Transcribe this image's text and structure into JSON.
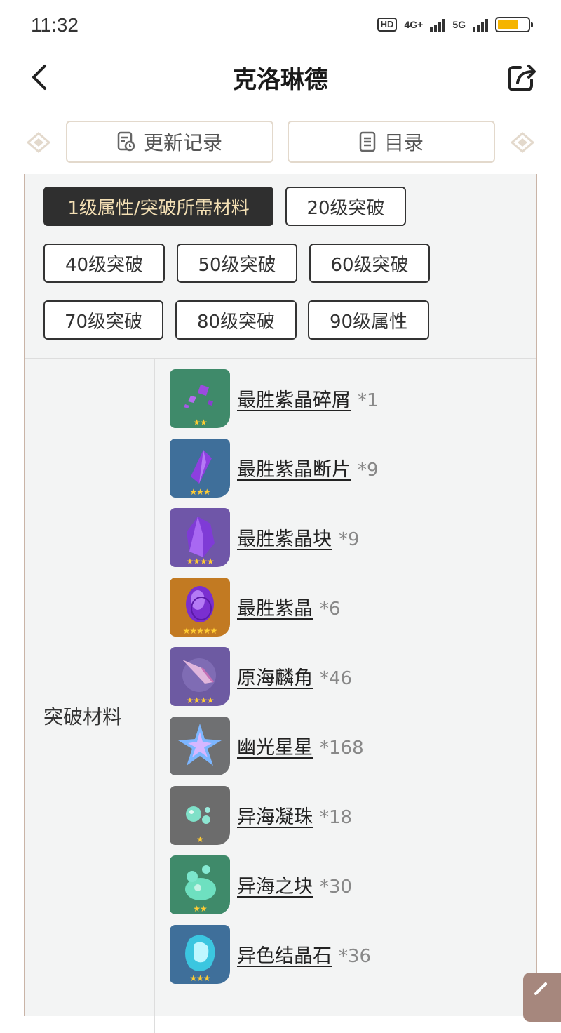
{
  "status": {
    "time": "11:32",
    "hd": "HD",
    "network1": "4G+",
    "network2": "5G",
    "battery_level": 0.68
  },
  "header": {
    "title": "克洛琳德"
  },
  "toolbar": {
    "update_label": "更新记录",
    "catalog_label": "目录"
  },
  "levels": [
    {
      "label": "1级属性/突破所需材料",
      "active": true
    },
    {
      "label": "20级突破",
      "active": false
    },
    {
      "label": "40级突破",
      "active": false
    },
    {
      "label": "50级突破",
      "active": false
    },
    {
      "label": "60级突破",
      "active": false
    },
    {
      "label": "70级突破",
      "active": false
    },
    {
      "label": "80级突破",
      "active": false
    },
    {
      "label": "90级属性",
      "active": false
    }
  ],
  "section": {
    "label": "突破材料"
  },
  "materials": [
    {
      "name": "最胜紫晶碎屑",
      "qty": "*1",
      "stars": "★★",
      "icon": "amethyst-sliver-icon",
      "bg": "#3f8a6a"
    },
    {
      "name": "最胜紫晶断片",
      "qty": "*9",
      "stars": "★★★",
      "icon": "amethyst-fragment-icon",
      "bg": "#3f6f9a"
    },
    {
      "name": "最胜紫晶块",
      "qty": "*9",
      "stars": "★★★★",
      "icon": "amethyst-chunk-icon",
      "bg": "#6f56a8"
    },
    {
      "name": "最胜紫晶",
      "qty": "*6",
      "stars": "★★★★★",
      "icon": "amethyst-gemstone-icon",
      "bg": "#c27a22"
    },
    {
      "name": "原海麟角",
      "qty": "*46",
      "stars": "★★★★",
      "icon": "fontemer-unihorn-icon",
      "bg": "#6d5aa2"
    },
    {
      "name": "幽光星星",
      "qty": "*168",
      "stars": "",
      "icon": "starconch-star-icon",
      "bg": "#6f7072"
    },
    {
      "name": "异海凝珠",
      "qty": "*18",
      "stars": "★",
      "icon": "transoceanic-pearl-icon",
      "bg": "#6c6c6c"
    },
    {
      "name": "异海之块",
      "qty": "*30",
      "stars": "★★",
      "icon": "transoceanic-chunk-icon",
      "bg": "#3f8a6a"
    },
    {
      "name": "异色结晶石",
      "qty": "*36",
      "stars": "★★★",
      "icon": "xenochromatic-crystal-icon",
      "bg": "#3f6f9a"
    }
  ]
}
